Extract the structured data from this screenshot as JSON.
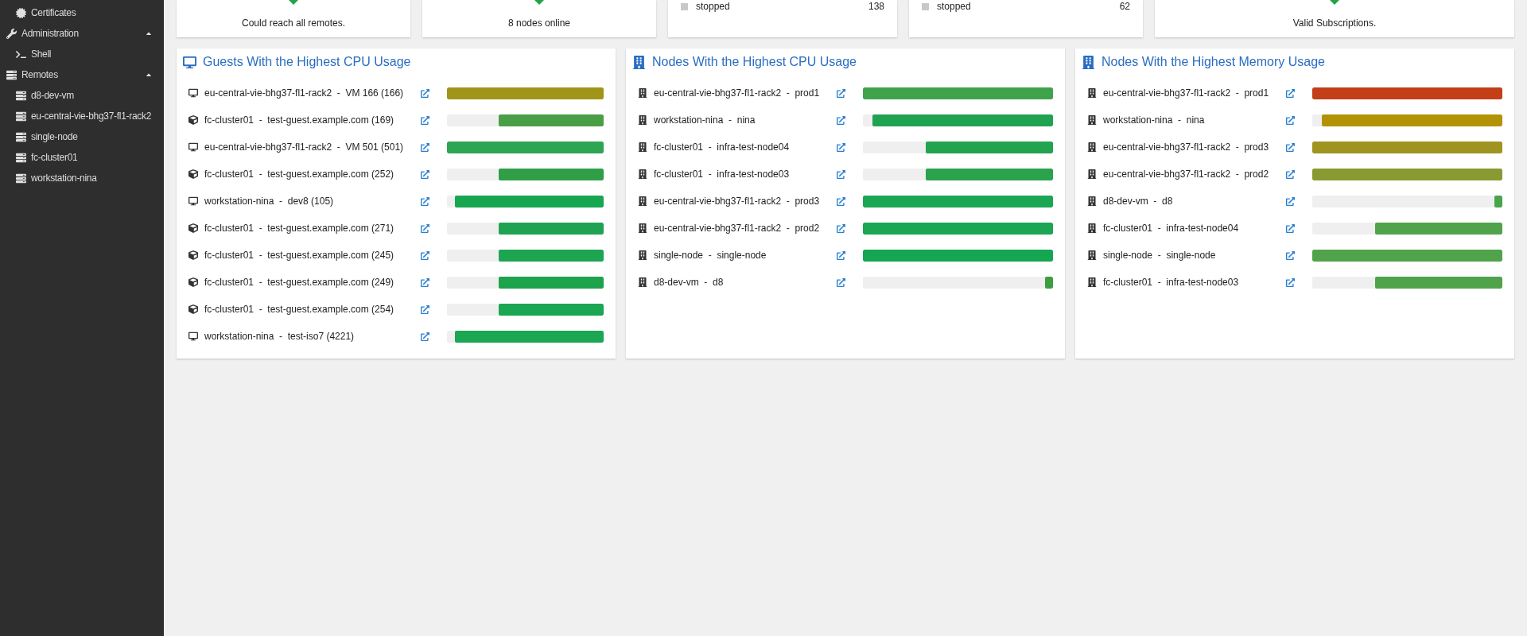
{
  "sidebar": {
    "items": [
      {
        "children": [
          {
            "label": "Certificates",
            "kind": "certificate"
          }
        ]
      },
      {
        "label": "Administration",
        "kind": "wrench",
        "expanded": true,
        "children": [
          {
            "label": "Shell",
            "kind": "terminal"
          }
        ]
      },
      {
        "label": "Remotes",
        "kind": "server",
        "expanded": true,
        "children": [
          {
            "label": "d8-dev-vm",
            "kind": "server"
          },
          {
            "label": "eu-central-vie-bhg37-fl1-rack2",
            "kind": "server"
          },
          {
            "label": "single-node",
            "kind": "server"
          },
          {
            "label": "fc-cluster01",
            "kind": "server"
          },
          {
            "label": "workstation-nina",
            "kind": "server"
          }
        ]
      }
    ]
  },
  "cards": [
    {
      "kind": "status",
      "text": "Could reach all remotes."
    },
    {
      "kind": "status",
      "text": "8 nodes online"
    },
    {
      "kind": "counts",
      "rows": [
        {
          "label": "stopped",
          "value": "138"
        }
      ]
    },
    {
      "kind": "counts",
      "rows": [
        {
          "label": "stopped",
          "value": "62"
        }
      ]
    },
    {
      "kind": "status",
      "text": "Valid Subscriptions."
    }
  ],
  "panels": [
    {
      "title": "Guests With the Highest CPU Usage",
      "kind": "vm",
      "rows": [
        {
          "kind": "vm",
          "text": "eu-central-vie-bhg37-fl1-rack2  -  VM 166 (166)",
          "level": 1,
          "color": "#a09419"
        },
        {
          "kind": "container",
          "text": "fc-cluster01  -  test-guest.example.com (169)",
          "level": 0.67,
          "color": "#4a9e45"
        },
        {
          "kind": "vm",
          "text": "eu-central-vie-bhg37-fl1-rack2  -  VM 501 (501)",
          "level": 1,
          "color": "#2ea552"
        },
        {
          "kind": "container",
          "text": "fc-cluster01  -  test-guest.example.com (252)",
          "level": 0.67,
          "color": "#2f9e47"
        },
        {
          "kind": "vm",
          "text": "workstation-nina  -  dev8 (105)",
          "level": 0.95,
          "color": "#17a650"
        },
        {
          "kind": "container",
          "text": "fc-cluster01  -  test-guest.example.com (271)",
          "level": 0.67,
          "color": "#1fa350"
        },
        {
          "kind": "container",
          "text": "fc-cluster01  -  test-guest.example.com (245)",
          "level": 0.67,
          "color": "#1ea552"
        },
        {
          "kind": "container",
          "text": "fc-cluster01  -  test-guest.example.com (249)",
          "level": 0.67,
          "color": "#1ca34c"
        },
        {
          "kind": "container",
          "text": "fc-cluster01  -  test-guest.example.com (254)",
          "level": 0.67,
          "color": "#1aa652"
        },
        {
          "kind": "vm",
          "text": "workstation-nina  -  test-iso7 (4221)",
          "level": 0.95,
          "color": "#1aa652"
        }
      ]
    },
    {
      "title": "Nodes With the Highest CPU Usage",
      "kind": "node",
      "rows": [
        {
          "kind": "node",
          "text": "eu-central-vie-bhg37-fl1-rack2  -  prod1",
          "level": 1,
          "color": "#3fa34c"
        },
        {
          "kind": "node",
          "text": "workstation-nina  -  nina",
          "level": 0.95,
          "color": "#1fa350"
        },
        {
          "kind": "node",
          "text": "fc-cluster01  -  infra-test-node04",
          "level": 0.67,
          "color": "#22a34e"
        },
        {
          "kind": "node",
          "text": "fc-cluster01  -  infra-test-node03",
          "level": 0.67,
          "color": "#2ba24c"
        },
        {
          "kind": "node",
          "text": "eu-central-vie-bhg37-fl1-rack2  -  prod3",
          "level": 1,
          "color": "#1aa652"
        },
        {
          "kind": "node",
          "text": "eu-central-vie-bhg37-fl1-rack2  -  prod2",
          "level": 1,
          "color": "#1aa652"
        },
        {
          "kind": "node",
          "text": "single-node  -  single-node",
          "level": 1,
          "color": "#14a652"
        },
        {
          "kind": "node",
          "text": "d8-dev-vm  -  d8",
          "level": 0.04,
          "color": "#3c9e40"
        }
      ]
    },
    {
      "title": "Nodes With the Highest Memory Usage",
      "kind": "node",
      "rows": [
        {
          "kind": "node",
          "text": "eu-central-vie-bhg37-fl1-rack2  -  prod1",
          "level": 1,
          "color": "#c23f18"
        },
        {
          "kind": "node",
          "text": "workstation-nina  -  nina",
          "level": 0.95,
          "color": "#b39306"
        },
        {
          "kind": "node",
          "text": "eu-central-vie-bhg37-fl1-rack2  -  prod3",
          "level": 1,
          "color": "#a09421"
        },
        {
          "kind": "node",
          "text": "eu-central-vie-bhg37-fl1-rack2  -  prod2",
          "level": 1,
          "color": "#889a31"
        },
        {
          "kind": "node",
          "text": "d8-dev-vm  -  d8",
          "level": 0.04,
          "color": "#4aa44a"
        },
        {
          "kind": "node",
          "text": "fc-cluster01  -  infra-test-node04",
          "level": 0.67,
          "color": "#50a34b"
        },
        {
          "kind": "node",
          "text": "single-node  -  single-node",
          "level": 1,
          "color": "#50a34b"
        },
        {
          "kind": "node",
          "text": "fc-cluster01  -  infra-test-node03",
          "level": 0.67,
          "color": "#50a34b"
        }
      ]
    }
  ]
}
